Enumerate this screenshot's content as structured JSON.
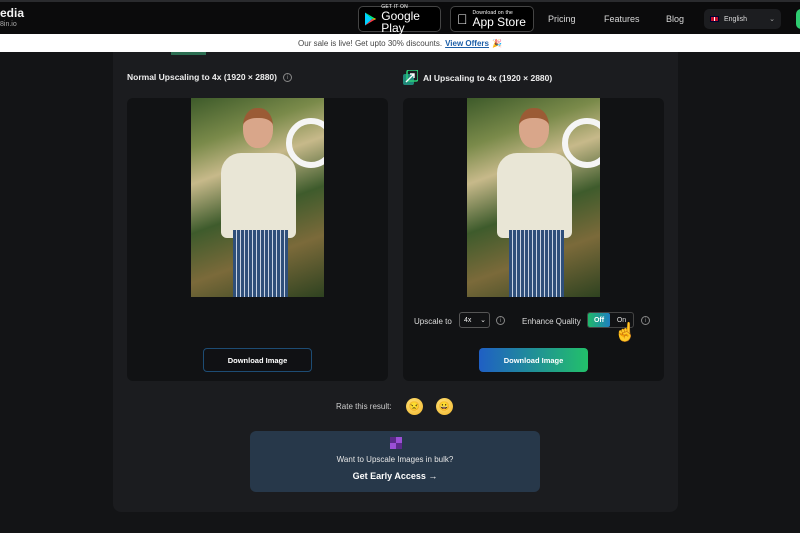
{
  "header": {
    "logo_line1": "edia",
    "logo_line2": "8in.io",
    "google_play": {
      "small": "GET IT ON",
      "big": "Google Play"
    },
    "app_store": {
      "small": "Download on the",
      "big": "App Store"
    },
    "nav": [
      "Pricing",
      "Features",
      "Blog"
    ],
    "language": "English"
  },
  "banner": {
    "text": "Our sale is live! Get upto 30% discounts.",
    "link": "View Offers",
    "emoji": "🎉"
  },
  "normal": {
    "title": "Normal Upscaling to 4x (1920 × 2880)",
    "download_label": "Download Image"
  },
  "ai": {
    "title": "AI Upscaling to 4x (1920 × 2880)",
    "upscale_label": "Upscale to",
    "upscale_value": "4x",
    "enhance_label": "Enhance Quality",
    "toggle_off": "Off",
    "toggle_on": "On",
    "download_label": "Download Image"
  },
  "rating": {
    "label": "Rate this result:",
    "emojis": [
      "😒",
      "😀"
    ]
  },
  "bulk": {
    "question": "Want to Upscale Images in bulk?",
    "cta": "Get Early Access →"
  },
  "colors": {
    "accent_green": "#22c06a",
    "accent_blue": "#1f5fc4",
    "link": "#1d5fa8"
  }
}
